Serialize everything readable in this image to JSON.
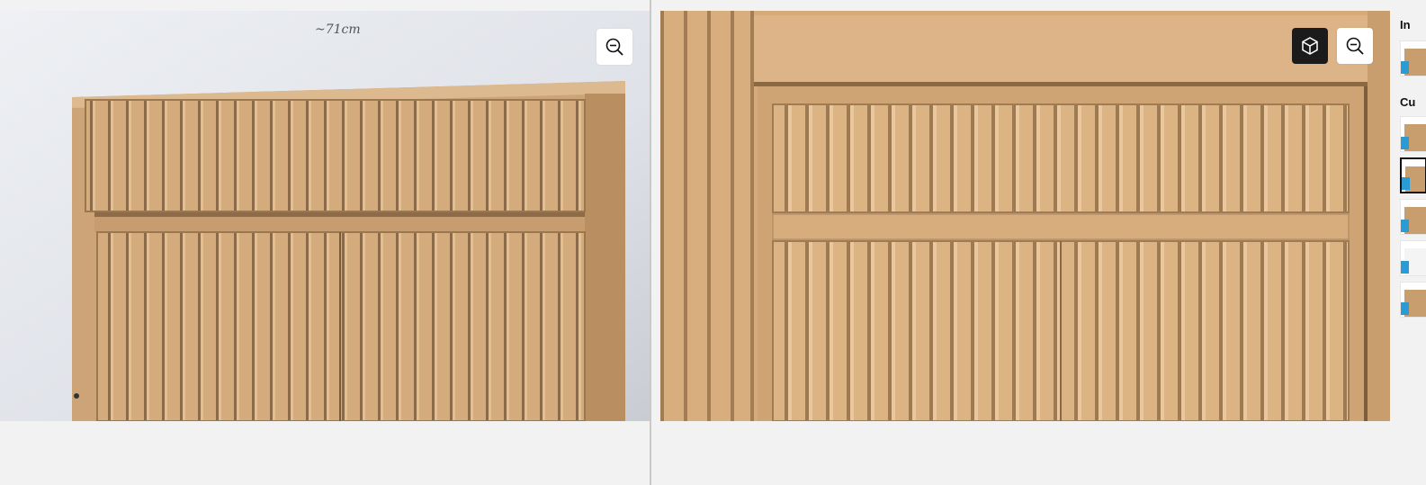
{
  "left_image": {
    "handwritten_note": "~71cm",
    "zoom_button_icon": "zoom-out-icon"
  },
  "right_image": {
    "view_3d_button_icon": "cube-3d-icon",
    "zoom_button_icon": "zoom-out-icon"
  },
  "side_panel": {
    "section1_title": "In",
    "section2_title": "Cu",
    "thumbnails": [
      {
        "section": 1,
        "selected": false
      },
      {
        "section": 2,
        "selected": false
      },
      {
        "section": 2,
        "selected": true
      },
      {
        "section": 2,
        "selected": false
      },
      {
        "section": 2,
        "selected": false
      },
      {
        "section": 2,
        "selected": false
      }
    ]
  },
  "colors": {
    "page_bg": "#f2f2f2",
    "oak": "#d6aa79",
    "dark_button": "#1b1b1b",
    "badge_blue": "#2b9bd6"
  }
}
